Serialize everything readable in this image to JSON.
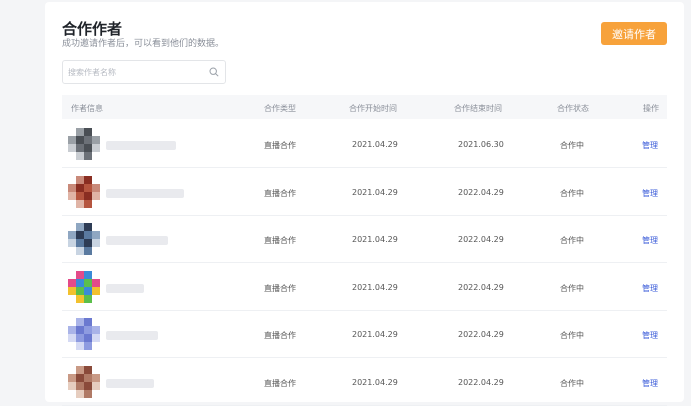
{
  "header": {
    "title": "合作作者",
    "subtitle": "成功邀请作者后，可以看到他们的数据。",
    "invite_label": "邀请作者"
  },
  "search": {
    "placeholder": "搜索作者名称"
  },
  "table": {
    "columns": [
      "作者信息",
      "合作类型",
      "合作开始时间",
      "合作结束时间",
      "合作状态",
      "操作"
    ],
    "rows": [
      {
        "type": "直播合作",
        "start": "2021.04.29",
        "end": "2021.06.30",
        "status": "合作中",
        "action": "管理",
        "avatar_colors": [
          "#9aa0a6",
          "#4a4f55",
          "#6c7178",
          "#c9cdd2"
        ]
      },
      {
        "type": "直播合作",
        "start": "2021.04.29",
        "end": "2022.04.29",
        "status": "合作中",
        "action": "管理",
        "avatar_colors": [
          "#c98a7a",
          "#8a2e22",
          "#b5553f",
          "#e0b4a6"
        ]
      },
      {
        "type": "直播合作",
        "start": "2021.04.29",
        "end": "2022.04.29",
        "status": "合作中",
        "action": "管理",
        "avatar_colors": [
          "#8fa7c2",
          "#2d3c55",
          "#5a7aa0",
          "#c8d4e2"
        ]
      },
      {
        "type": "直播合作",
        "start": "2021.04.29",
        "end": "2022.04.29",
        "status": "合作中",
        "action": "管理",
        "avatar_colors": [
          "#e34b8a",
          "#3a8bd8",
          "#5bbf4a",
          "#f2c12e"
        ]
      },
      {
        "type": "直播合作",
        "start": "2021.04.29",
        "end": "2022.04.29",
        "status": "合作中",
        "action": "管理",
        "avatar_colors": [
          "#aab4e8",
          "#6b79d0",
          "#8e9be0",
          "#d5daf4"
        ]
      },
      {
        "type": "直播合作",
        "start": "2021.04.29",
        "end": "2022.04.29",
        "status": "合作中",
        "action": "管理",
        "avatar_colors": [
          "#c99a86",
          "#8a4a3a",
          "#b07a66",
          "#e6cdbf"
        ]
      }
    ]
  }
}
